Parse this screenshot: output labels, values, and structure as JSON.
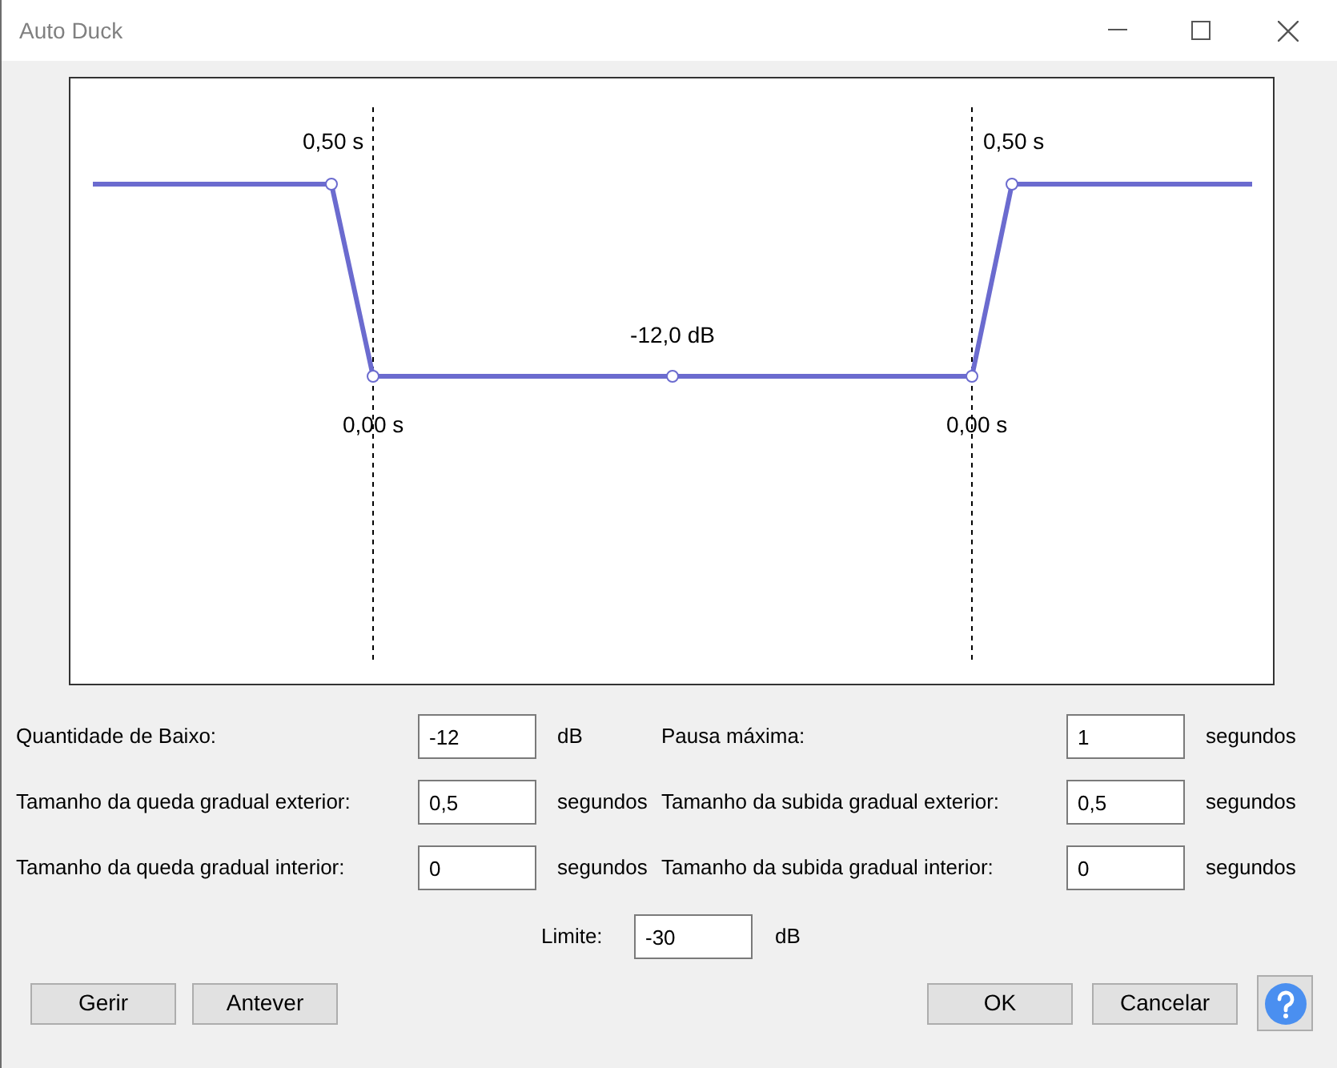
{
  "window": {
    "title": "Auto Duck"
  },
  "graph": {
    "outer_fade_down_label": "0,50 s",
    "outer_fade_up_label": "0,50 s",
    "duck_amount_label": "-12,0 dB",
    "inner_fade_down_label": "0,00 s",
    "inner_fade_up_label": "0,00 s"
  },
  "fields": [
    {
      "label": "Quantidade de Baixo:",
      "value": "-12",
      "unit": "dB"
    },
    {
      "label": "Pausa máxima:",
      "value": "1",
      "unit": "segundos"
    },
    {
      "label": "Tamanho da queda gradual exterior:",
      "value": "0,5",
      "unit": "segundos"
    },
    {
      "label": "Tamanho da subida gradual exterior:",
      "value": "0,5",
      "unit": "segundos"
    },
    {
      "label": "Tamanho da queda gradual interior:",
      "value": "0",
      "unit": "segundos"
    },
    {
      "label": "Tamanho da subida gradual interior:",
      "value": "0",
      "unit": "segundos"
    }
  ],
  "threshold": {
    "label": "Limite:",
    "value": "-30",
    "unit": "dB"
  },
  "left_buttons": [
    "Gerir",
    "Antever"
  ],
  "right_buttons": [
    "OK",
    "Cancelar"
  ]
}
